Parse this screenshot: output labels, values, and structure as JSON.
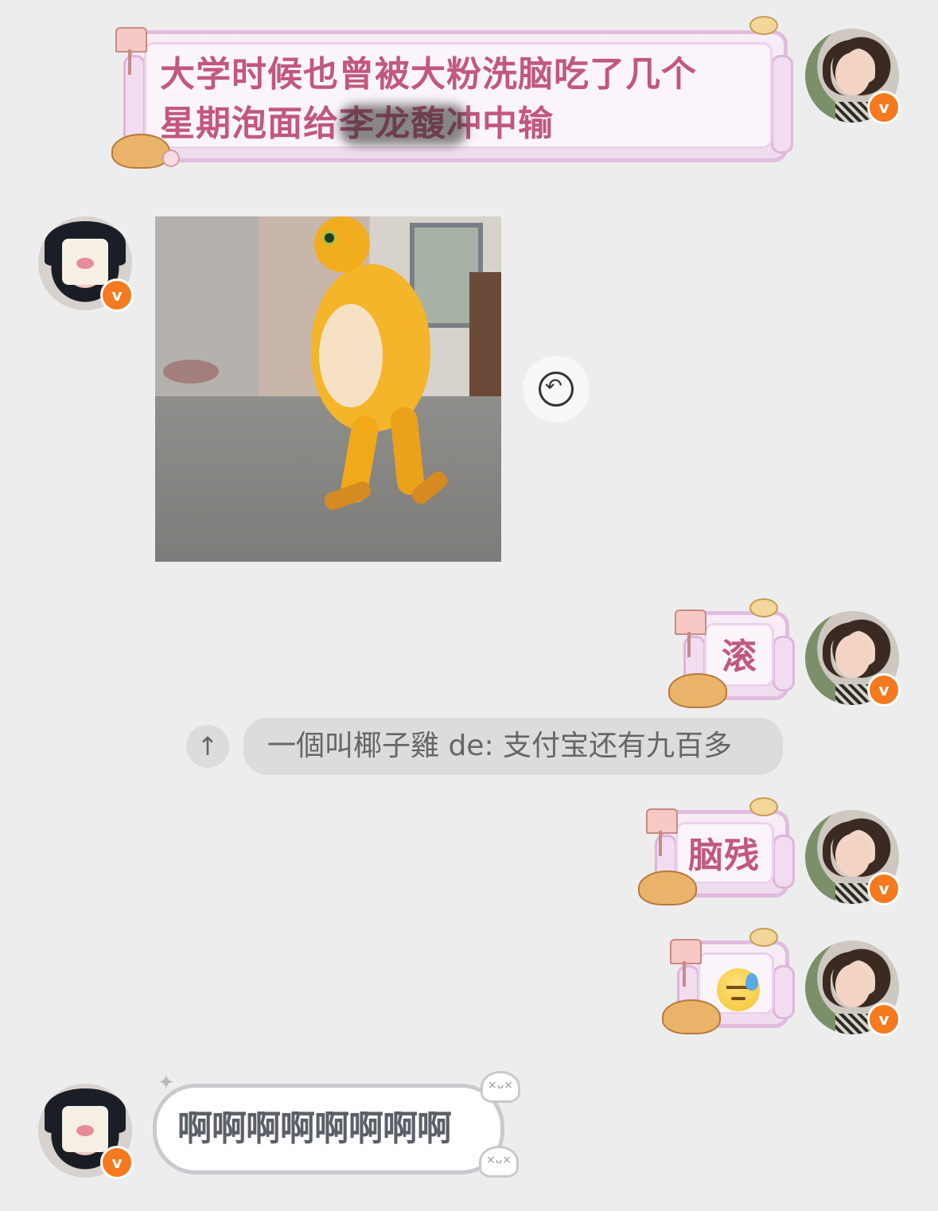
{
  "messages": [
    {
      "sender": "me",
      "type": "text",
      "text": "大学时候也曾被大粉洗脑吃了几个星期泡面给李龙馥冲中输",
      "line1": "大学时候也曾被大粉洗脑吃了几个",
      "line2": "星期泡面给李龙馥冲中输",
      "redacted": "李龙馥"
    },
    {
      "sender": "other",
      "type": "image",
      "image_desc_icon": "chick-meme"
    },
    {
      "sender": "me",
      "type": "text",
      "text": "滚"
    },
    {
      "sender": "me",
      "type": "text",
      "text": "脑残"
    },
    {
      "sender": "me",
      "type": "emoji",
      "emoji": "😓"
    },
    {
      "sender": "other",
      "type": "text",
      "text": "啊啊啊啊啊啊啊啊"
    }
  ],
  "quote": {
    "up_icon": "↑",
    "text": "一個叫椰子雞 de: 支付宝还有九百多"
  },
  "badge_letter": "v",
  "reply_icon": "↶",
  "colors": {
    "bubble_text": "#c2587e",
    "badge": "#f57a1f",
    "background": "#ededed"
  }
}
